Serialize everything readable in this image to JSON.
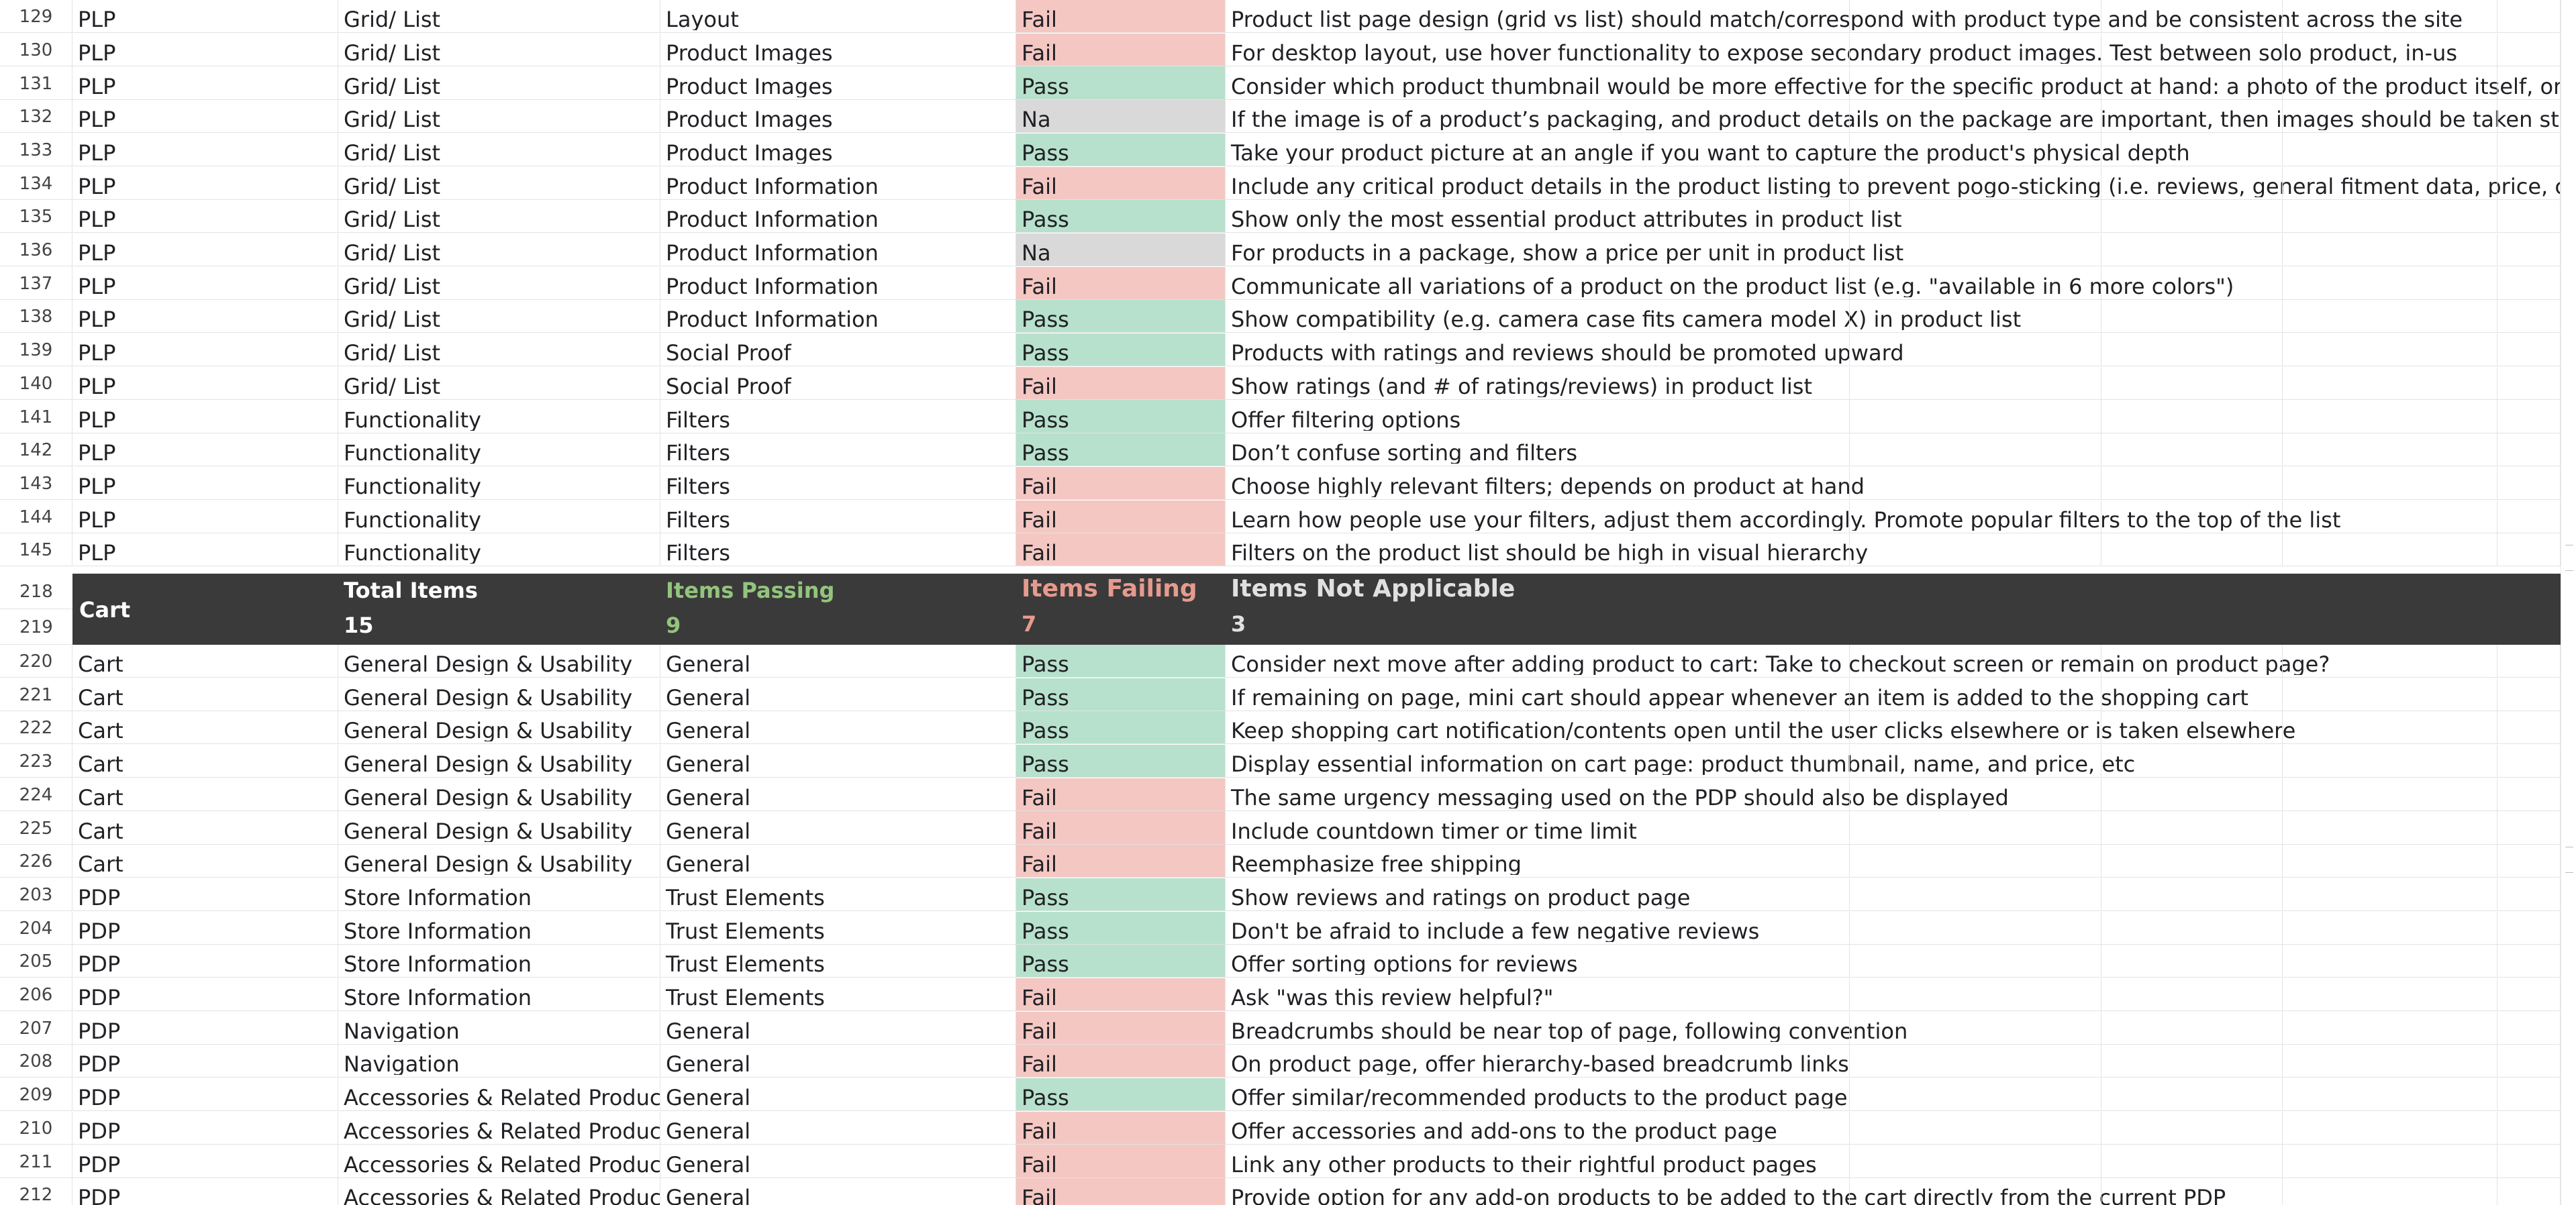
{
  "rows_top": [
    {
      "n": "129",
      "page": "PLP",
      "section": "Grid/ List",
      "category": "Layout",
      "status": "Fail",
      "desc": "Product list page design (grid vs list) should match/correspond with product type and be consistent across the site"
    },
    {
      "n": "130",
      "page": "PLP",
      "section": "Grid/ List",
      "category": "Product Images",
      "status": "Fail",
      "desc": "For desktop layout, use hover functionality to expose secondary product images. Test between solo product, in-us"
    },
    {
      "n": "131",
      "page": "PLP",
      "section": "Grid/ List",
      "category": "Product Images",
      "status": "Pass",
      "desc": "Consider which product thumbnail would be more effective for the specific product at hand: a photo of the product itself, or"
    },
    {
      "n": "132",
      "page": "PLP",
      "section": "Grid/ List",
      "category": "Product Images",
      "status": "Na",
      "desc": "If the image is of a product’s packaging, and product details on the package are important, then images should be taken str"
    },
    {
      "n": "133",
      "page": "PLP",
      "section": "Grid/ List",
      "category": "Product Images",
      "status": "Pass",
      "desc": "Take your product picture at an angle if you want to capture the product's physical depth"
    },
    {
      "n": "134",
      "page": "PLP",
      "section": "Grid/ List",
      "category": "Product Information",
      "status": "Fail",
      "desc": "Include any critical product details in the product listing to prevent pogo-sticking (i.e. reviews, general fitment data, price, co"
    },
    {
      "n": "135",
      "page": "PLP",
      "section": "Grid/ List",
      "category": "Product Information",
      "status": "Pass",
      "desc": "Show only the most essential product attributes in product list"
    },
    {
      "n": "136",
      "page": "PLP",
      "section": "Grid/ List",
      "category": "Product Information",
      "status": "Na",
      "desc": "For products in a package, show a price per unit in product list"
    },
    {
      "n": "137",
      "page": "PLP",
      "section": "Grid/ List",
      "category": "Product Information",
      "status": "Fail",
      "desc": "Communicate all variations of a product on the product list (e.g. \"available in 6 more colors\")"
    },
    {
      "n": "138",
      "page": "PLP",
      "section": "Grid/ List",
      "category": "Product Information",
      "status": "Pass",
      "desc": "Show compatibility (e.g. camera case fits camera model X) in product list"
    },
    {
      "n": "139",
      "page": "PLP",
      "section": "Grid/ List",
      "category": "Social Proof",
      "status": "Pass",
      "desc": "Products with ratings and reviews should be promoted upward"
    },
    {
      "n": "140",
      "page": "PLP",
      "section": "Grid/ List",
      "category": "Social Proof",
      "status": "Fail",
      "desc": "Show ratings (and # of ratings/reviews) in product list"
    },
    {
      "n": "141",
      "page": "PLP",
      "section": "Functionality",
      "category": "Filters",
      "status": "Pass",
      "desc": "Offer filtering options"
    },
    {
      "n": "142",
      "page": "PLP",
      "section": "Functionality",
      "category": "Filters",
      "status": "Pass",
      "desc": "Don’t confuse sorting and filters"
    },
    {
      "n": "143",
      "page": "PLP",
      "section": "Functionality",
      "category": "Filters",
      "status": "Fail",
      "desc": "Choose highly relevant filters; depends on product at hand"
    },
    {
      "n": "144",
      "page": "PLP",
      "section": "Functionality",
      "category": "Filters",
      "status": "Fail",
      "desc": "Learn how people use your filters, adjust them accordingly. Promote popular filters to the top of the list"
    },
    {
      "n": "145",
      "page": "PLP",
      "section": "Functionality",
      "category": "Filters",
      "status": "Fail",
      "desc": "Filters on the product list should be high in visual hierarchy"
    }
  ],
  "summary": {
    "row_a": "218",
    "row_b": "219",
    "label": "Cart",
    "total_label": "Total Items",
    "total_value": "15",
    "passing_label": "Items Passing",
    "passing_value": "9",
    "failing_label": "Items Failing",
    "failing_value": "7",
    "na_label": "Items Not Applicable",
    "na_value": "3"
  },
  "rows_bottom": [
    {
      "n": "220",
      "page": "Cart",
      "section": "General Design & Usability",
      "category": "General",
      "status": "Pass",
      "desc": "Consider next move after adding product to cart: Take to checkout screen or remain on product page?"
    },
    {
      "n": "221",
      "page": "Cart",
      "section": "General Design & Usability",
      "category": "General",
      "status": "Pass",
      "desc": "If remaining on page, mini cart should appear whenever an item is added to the shopping cart"
    },
    {
      "n": "222",
      "page": "Cart",
      "section": "General Design & Usability",
      "category": "General",
      "status": "Pass",
      "desc": "Keep shopping cart notification/contents open until the user clicks elsewhere or is taken elsewhere"
    },
    {
      "n": "223",
      "page": "Cart",
      "section": "General Design & Usability",
      "category": "General",
      "status": "Pass",
      "desc": "Display essential information on cart page: product thumbnail, name, and price, etc"
    },
    {
      "n": "224",
      "page": "Cart",
      "section": "General Design & Usability",
      "category": "General",
      "status": "Fail",
      "desc": "The same urgency messaging used on the PDP should also be displayed"
    },
    {
      "n": "225",
      "page": "Cart",
      "section": "General Design & Usability",
      "category": "General",
      "status": "Fail",
      "desc": "Include countdown timer or time limit"
    },
    {
      "n": "226",
      "page": "Cart",
      "section": "General Design & Usability",
      "category": "General",
      "status": "Fail",
      "desc": "Reemphasize free shipping"
    },
    {
      "n": "203",
      "page": "PDP",
      "section": "Store Information",
      "category": "Trust Elements",
      "status": "Pass",
      "desc": "Show reviews and ratings on product page"
    },
    {
      "n": "204",
      "page": "PDP",
      "section": "Store Information",
      "category": "Trust Elements",
      "status": "Pass",
      "desc": "Don't be afraid to include a few negative reviews"
    },
    {
      "n": "205",
      "page": "PDP",
      "section": "Store Information",
      "category": "Trust Elements",
      "status": "Pass",
      "desc": "Offer sorting options for reviews"
    },
    {
      "n": "206",
      "page": "PDP",
      "section": "Store Information",
      "category": "Trust Elements",
      "status": "Fail",
      "desc": "Ask \"was this review helpful?\""
    },
    {
      "n": "207",
      "page": "PDP",
      "section": "Navigation",
      "category": "General",
      "status": "Fail",
      "desc": "Breadcrumbs should be near top of page, following convention"
    },
    {
      "n": "208",
      "page": "PDP",
      "section": "Navigation",
      "category": "General",
      "status": "Fail",
      "desc": "On product page, offer hierarchy-based breadcrumb links"
    },
    {
      "n": "209",
      "page": "PDP",
      "section": "Accessories & Related Produc",
      "category": "General",
      "status": "Pass",
      "desc": "Offer similar/recommended products to the product page"
    },
    {
      "n": "210",
      "page": "PDP",
      "section": "Accessories & Related Produc",
      "category": "General",
      "status": "Fail",
      "desc": "Offer accessories and add-ons to the product page"
    },
    {
      "n": "211",
      "page": "PDP",
      "section": "Accessories & Related Produc",
      "category": "General",
      "status": "Fail",
      "desc": "Link any other products to their rightful product pages"
    },
    {
      "n": "212",
      "page": "PDP",
      "section": "Accessories & Related Produc",
      "category": "General",
      "status": "Fail",
      "desc": "Provide option for any add-on products to be added to the cart directly from the current PDP"
    }
  ],
  "status_colors": {
    "Fail": "#f4c7c3",
    "Pass": "#b7e1cd",
    "Na": "#d9d9d9"
  }
}
